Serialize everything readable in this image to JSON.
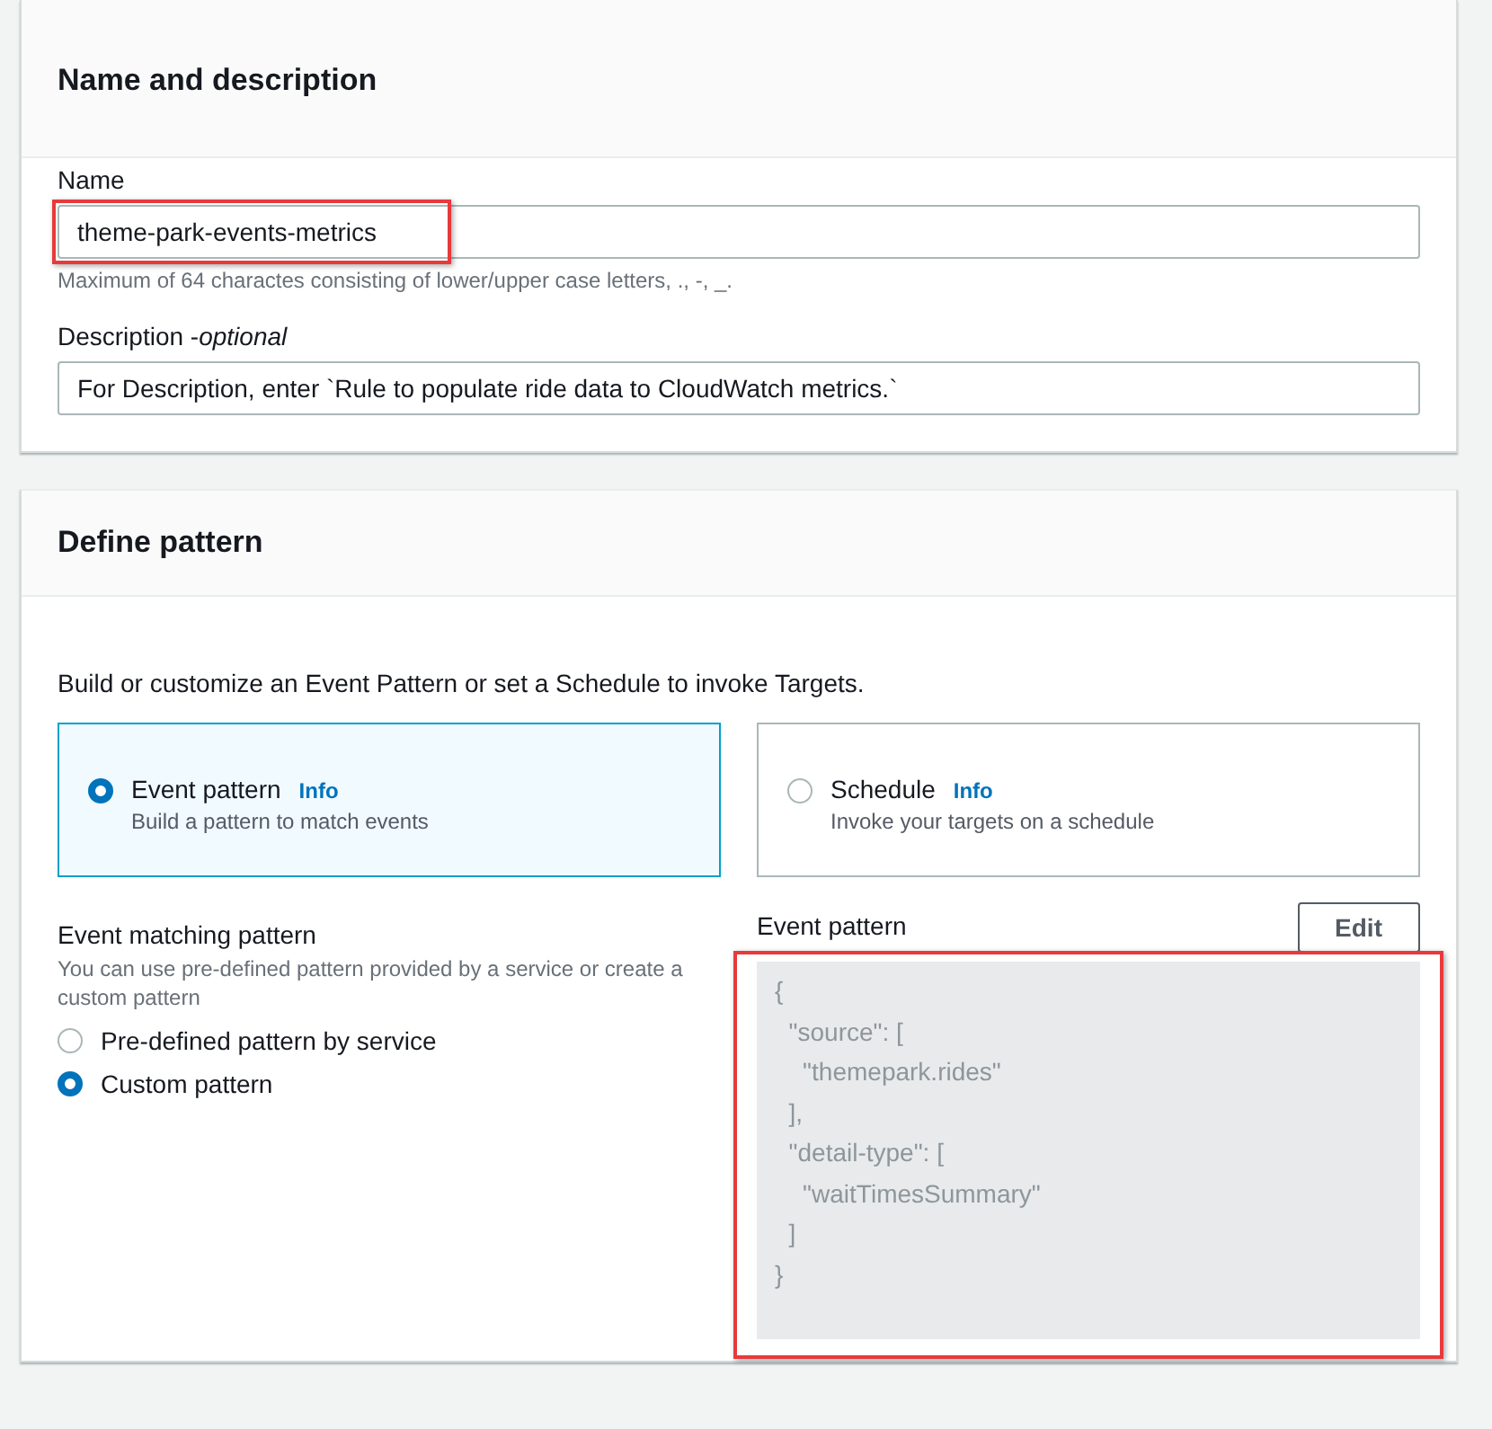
{
  "name_section": {
    "title": "Name and description",
    "name": {
      "label": "Name",
      "value": "theme-park-events-metrics",
      "highlighted": true,
      "hint": "Maximum of 64 charactes consisting of lower/upper case letters, ., -, _."
    },
    "description": {
      "label": "Description",
      "separator": "-",
      "optional": "optional",
      "value": "For Description, enter `Rule to populate ride data to CloudWatch metrics.`"
    }
  },
  "pattern_section": {
    "title": "Define pattern",
    "intro": "Build or customize an Event Pattern or set a Schedule to invoke Targets.",
    "options": [
      {
        "title": "Event pattern",
        "info": "Info",
        "description": "Build a pattern to match events",
        "selected": true
      },
      {
        "title": "Schedule",
        "info": "Info",
        "description": "Invoke your targets on a schedule",
        "selected": false
      }
    ],
    "matching": {
      "title": "Event matching pattern",
      "description": "You can use pre-defined pattern provided by a service or create a custom pattern",
      "choices": [
        {
          "label": "Pre-defined pattern by service",
          "selected": false
        },
        {
          "label": "Custom pattern",
          "selected": true
        }
      ]
    },
    "editor": {
      "label": "Event pattern",
      "button": "Edit",
      "highlighted": true,
      "lines": [
        "{",
        "  \"source\": [",
        "    \"themepark.rides\"",
        "  ],",
        "  \"detail-type\": [",
        "    \"waitTimesSummary\"",
        "  ]",
        "}"
      ]
    }
  }
}
